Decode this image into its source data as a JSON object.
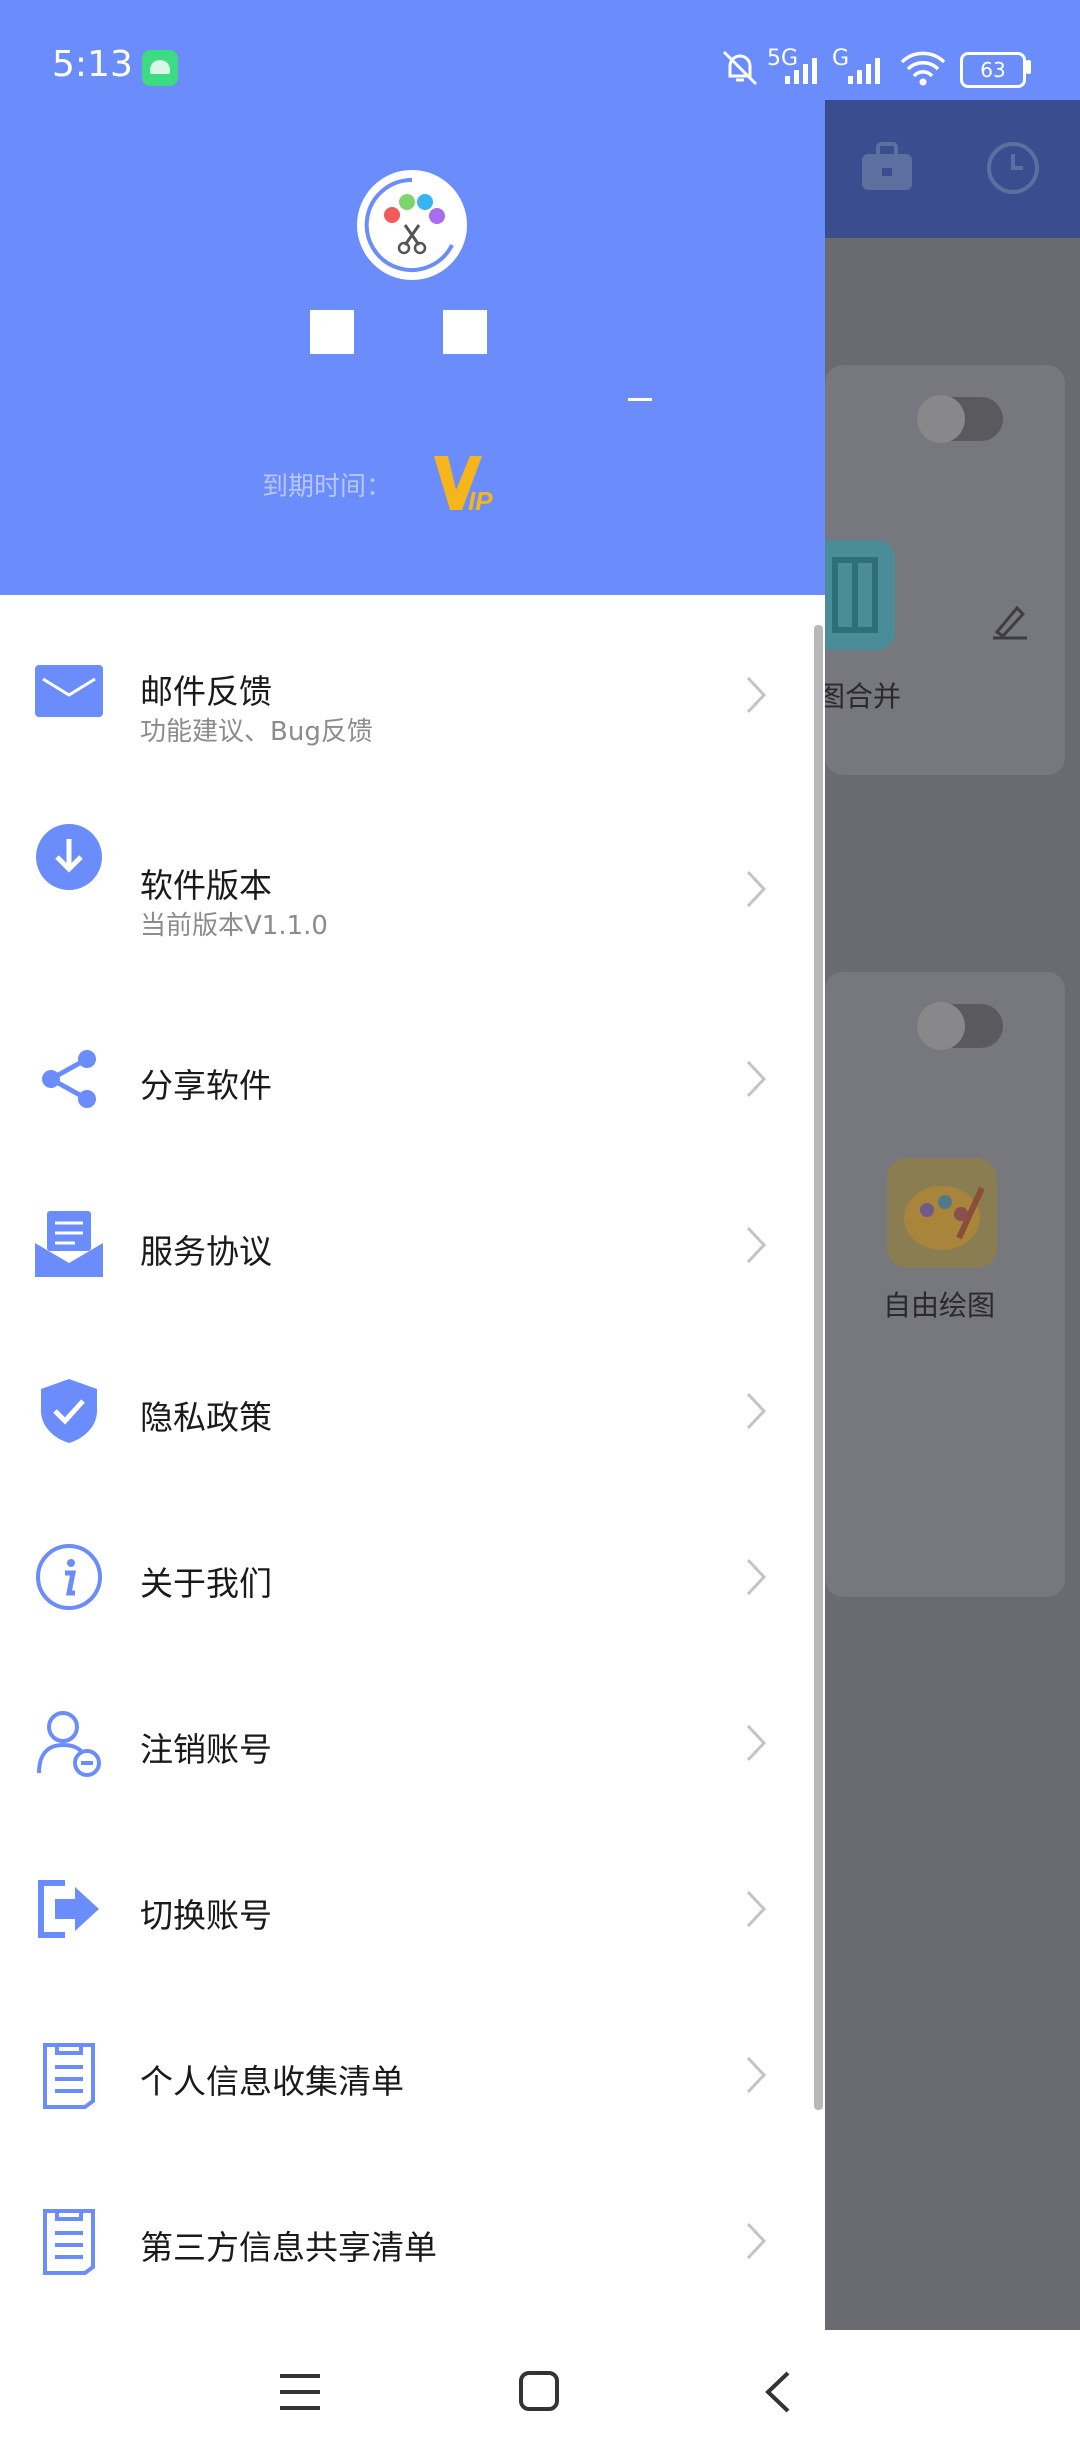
{
  "status_bar": {
    "time": "5:13",
    "network_1": "5G",
    "network_2": "G",
    "battery": "63"
  },
  "drawer": {
    "expiry_label": "到期时间：",
    "vip_badge": "VIP",
    "menu": [
      {
        "title": "邮件反馈",
        "subtitle": "功能建议、Bug反馈",
        "icon": "mail-icon"
      },
      {
        "title": "软件版本",
        "subtitle": "当前版本V1.1.0",
        "icon": "download-icon"
      },
      {
        "title": "分享软件",
        "icon": "share-icon"
      },
      {
        "title": "服务协议",
        "icon": "agreement-icon"
      },
      {
        "title": "隐私政策",
        "icon": "shield-icon"
      },
      {
        "title": "关于我们",
        "icon": "info-icon"
      },
      {
        "title": "注销账号",
        "icon": "user-remove-icon"
      },
      {
        "title": "切换账号",
        "icon": "logout-icon"
      },
      {
        "title": "个人信息收集清单",
        "icon": "list-icon"
      },
      {
        "title": "第三方信息共享清单",
        "icon": "list-icon"
      }
    ]
  },
  "background_app": {
    "merge_label": "图合并",
    "draw_label": "自由绘图"
  },
  "colors": {
    "accent": "#6b8cfb",
    "vip": "#f5b51b",
    "overlay": "#6a6b70"
  }
}
